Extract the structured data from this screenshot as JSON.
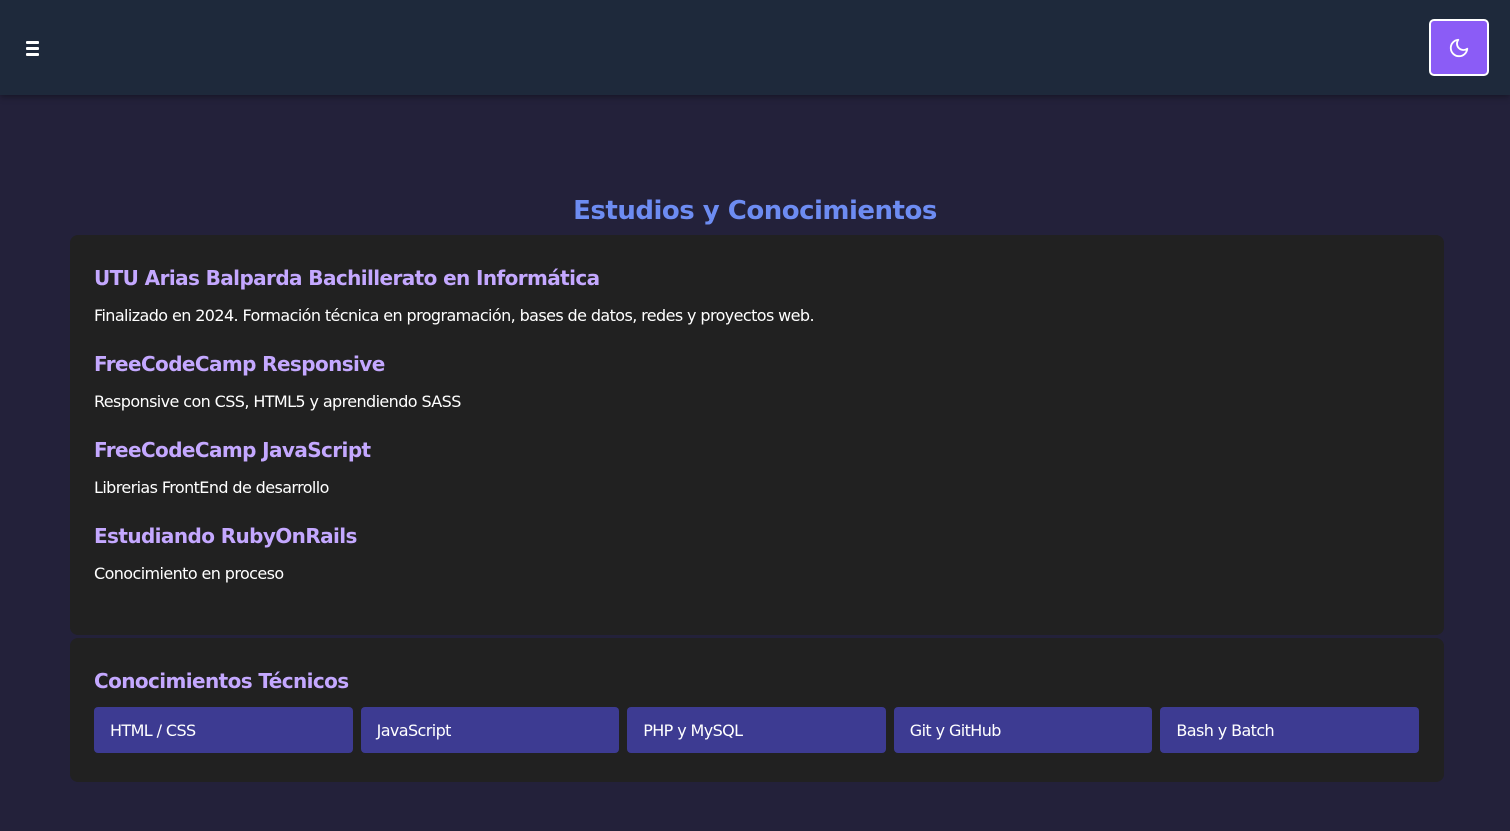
{
  "header": {
    "menu_icon": "hamburger-menu-icon",
    "theme_icon": "moon-icon"
  },
  "section": {
    "title": "Estudios y Conocimientos"
  },
  "studies": [
    {
      "title": "UTU Arias Balparda Bachillerato en Informática",
      "description": "Finalizado en 2024. Formación técnica en programación, bases de datos, redes y proyectos web."
    },
    {
      "title": "FreeCodeCamp Responsive",
      "description": "Responsive con CSS, HTML5 y aprendiendo SASS"
    },
    {
      "title": "FreeCodeCamp JavaScript",
      "description": "Librerias FrontEnd de desarrollo"
    },
    {
      "title": "Estudiando RubyOnRails",
      "description": "Conocimiento en proceso"
    }
  ],
  "skills": {
    "title": "Conocimientos Técnicos",
    "items": [
      "HTML / CSS",
      "JavaScript",
      "PHP y MySQL",
      "Git y GitHub",
      "Bash y Batch"
    ]
  },
  "colors": {
    "page_bg": "#23213a",
    "header_bg": "#1e293b",
    "card_bg": "#212121",
    "accent_button": "#8b5cf6",
    "section_title": "#6d8cf2",
    "item_title": "#c4a8ff",
    "chip_bg": "#3d3b92"
  }
}
